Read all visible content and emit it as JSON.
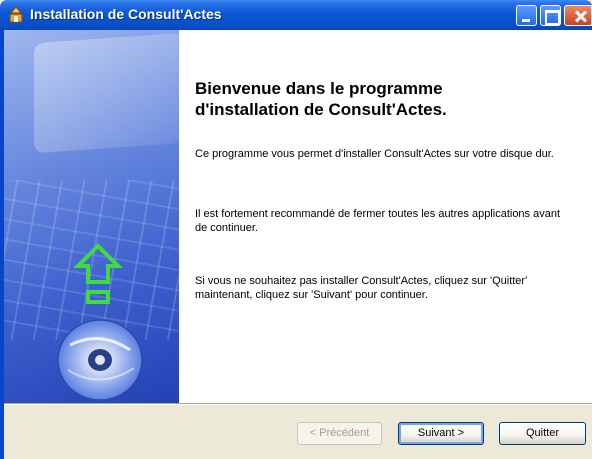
{
  "window": {
    "title": "Installation de Consult'Actes"
  },
  "content": {
    "welcome_title": "Bienvenue dans le programme d'installation de Consult'Actes.",
    "paragraph1": "Ce programme vous permet d'installer Consult'Actes sur votre disque dur.",
    "paragraph2": "Il est fortement recommandé de fermer toutes les autres applications avant de continuer.",
    "paragraph3": "Si vous ne souhaitez pas installer Consult'Actes, cliquez sur 'Quitter' maintenant, cliquez sur 'Suivant' pour continuer."
  },
  "buttons": {
    "previous": "< Précédent",
    "next": "Suivant >",
    "quit": "Quitter"
  },
  "colors": {
    "titlebar": "#0a58d6",
    "side_panel": "#3f62cf",
    "arrow": "#3fdc3f"
  },
  "icons": [
    "installer-icon",
    "minimize-icon",
    "maximize-icon",
    "close-icon",
    "upload-arrow-icon",
    "cd-icon"
  ]
}
